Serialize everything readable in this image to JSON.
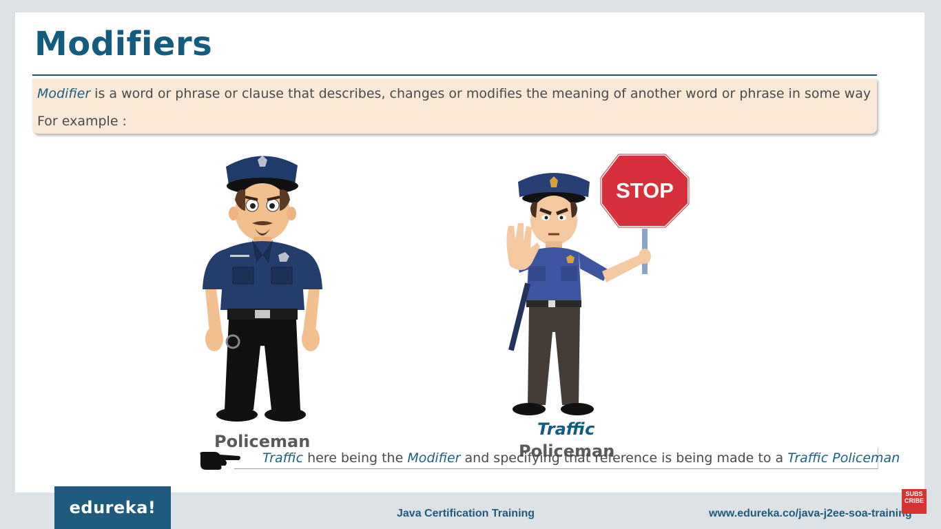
{
  "slide": {
    "title": "Modifiers",
    "definition": {
      "term": "Modifier",
      "rest": " is a word or phrase or clause that describes, changes or modifies the meaning of another word or phrase in some way",
      "example_label": "For example :"
    },
    "figures": {
      "left_caption": "Policeman",
      "right_caption_modifier": "Traffic",
      "right_caption_noun": "Policeman",
      "stop_sign_text": "STOP"
    },
    "note": {
      "part1": "Traffic",
      "part2": " here being the ",
      "part3": "Modifier",
      "part4": " and specifying that reference is being made to a ",
      "part5": "Traffic Policeman"
    }
  },
  "footer": {
    "logo": "edureka!",
    "course": "Java Certification Training",
    "url": "www.edureka.co/java-j2ee-soa-training",
    "subscribe_top": "SUBS",
    "subscribe_mid": "CRIBE"
  },
  "colors": {
    "accent": "#135c80",
    "definition_bg": "#fae9d6",
    "logo_bg": "#1e5b7f",
    "stop_red": "#d8303a"
  }
}
